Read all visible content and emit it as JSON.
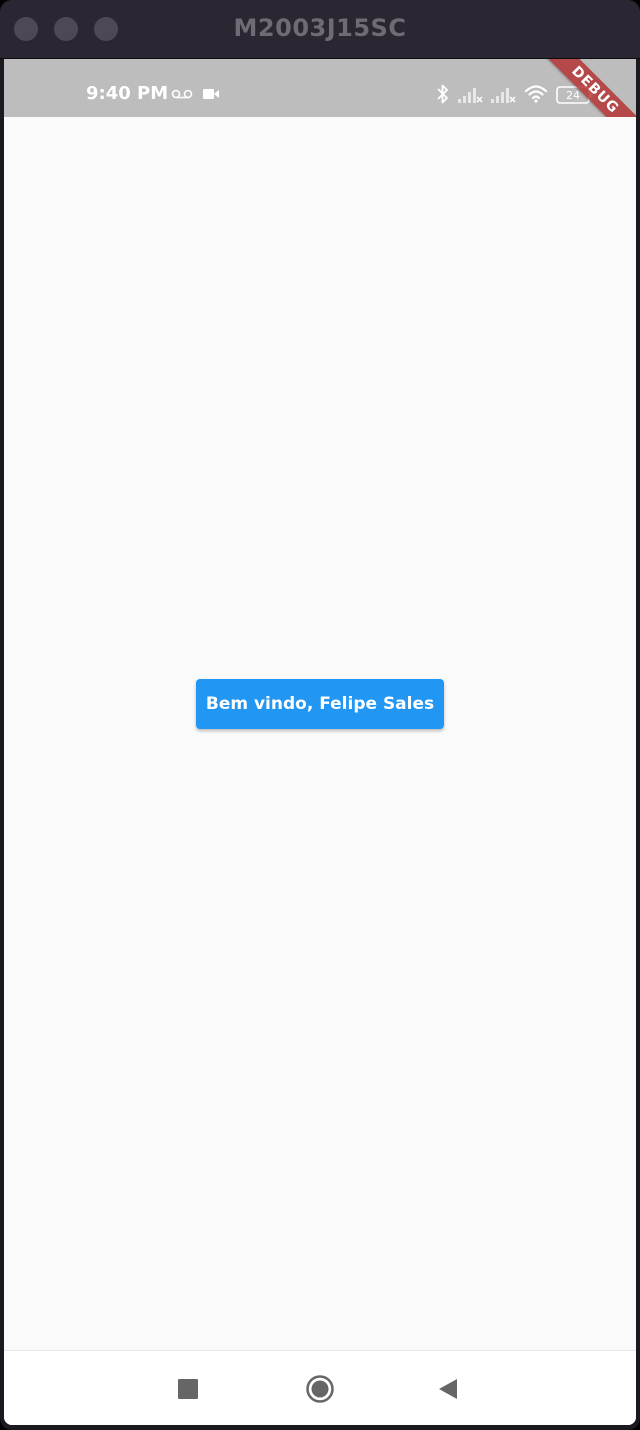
{
  "window": {
    "title": "M2003J15SC"
  },
  "status_bar": {
    "time": "9:40 PM",
    "battery_level": "24",
    "icons": [
      "voicemail-icon",
      "video-camera-icon",
      "bluetooth-icon",
      "signal-icon",
      "signal-icon",
      "wifi-icon",
      "battery-icon"
    ]
  },
  "debug_banner": {
    "label": "DEBUG"
  },
  "main": {
    "button_label": "Bem vindo, Felipe Sales"
  },
  "nav_bar": {
    "icons": [
      "recents-square-icon",
      "home-circle-icon",
      "back-triangle-icon"
    ]
  },
  "colors": {
    "button": "#2196f3",
    "status_bar": "#bdbdbd",
    "background": "#fafafa",
    "debug_ribbon": "#b33030"
  }
}
